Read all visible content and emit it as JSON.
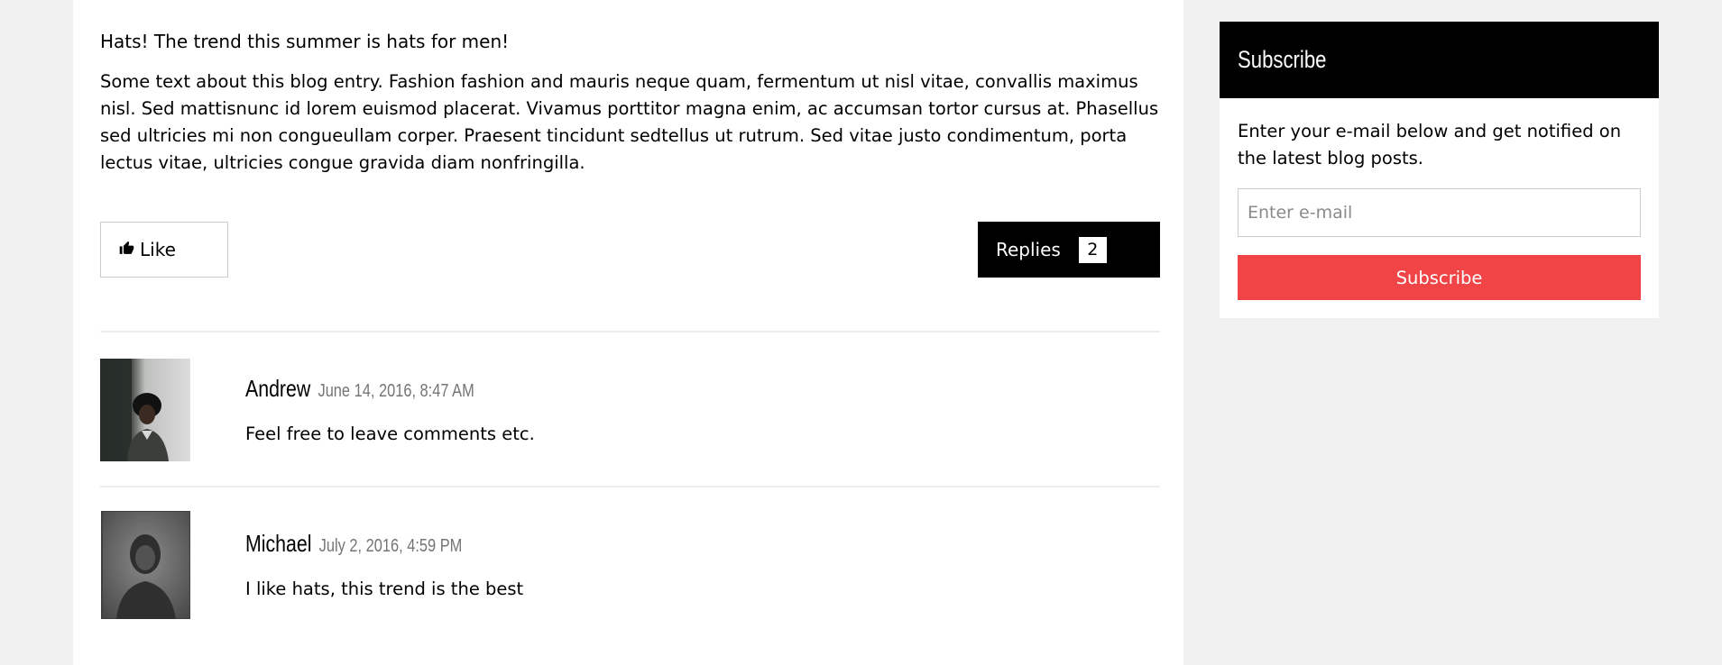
{
  "post": {
    "title": "Hats! The trend this summer is hats for men!",
    "body": "Some text about this blog entry. Fashion fashion and mauris neque quam, fermentum ut nisl vitae, convallis maximus nisl. Sed mattisnunc id lorem euismod placerat. Vivamus porttitor magna enim, ac accumsan tortor cursus at. Phasellus sed ultricies mi non congueullam corper. Praesent tincidunt sedtellus ut rutrum. Sed vitae justo condimentum, porta lectus vitae, ultricies congue gravida diam nonfringilla."
  },
  "actions": {
    "like_label": "Like",
    "like_icon": "thumbs-up-icon",
    "replies_label": "Replies",
    "replies_count": "2"
  },
  "comments": [
    {
      "name": "Andrew",
      "date": "June 14, 2016, 8:47 AM",
      "text": "Feel free to leave comments etc."
    },
    {
      "name": "Michael",
      "date": "July 2, 2016, 4:59 PM",
      "text": "I like hats, this trend is the best"
    }
  ],
  "sidebar": {
    "title": "Subscribe",
    "description": "Enter your e-mail below and get notified on the latest blog posts.",
    "email_placeholder": "Enter e-mail",
    "button_label": "Subscribe"
  },
  "colors": {
    "page_background": "#f1f1f1",
    "card_background": "#ffffff",
    "dark": "#000000",
    "accent_red": "#f04447",
    "muted_text": "#757575"
  }
}
